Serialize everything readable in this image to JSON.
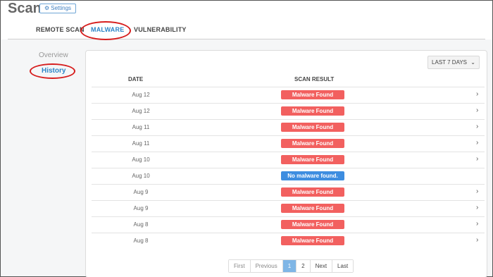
{
  "page": {
    "title": "Scan"
  },
  "header": {
    "settings_label": "Settings",
    "settings_icon": "gear-icon"
  },
  "tabs": [
    {
      "label": "REMOTE SCAN",
      "active": false
    },
    {
      "label": "MALWARE",
      "active": true
    },
    {
      "label": "VULNERABILITY",
      "active": false
    }
  ],
  "sidebar": {
    "items": [
      {
        "label": "Overview",
        "active": false
      },
      {
        "label": "History",
        "active": true
      }
    ]
  },
  "filter": {
    "range_label": "LAST 7 DAYS"
  },
  "table": {
    "columns": [
      "DATE",
      "SCAN RESULT"
    ],
    "rows": [
      {
        "date": "Aug 12",
        "result": "Malware Found",
        "status": "found",
        "has_details": true
      },
      {
        "date": "Aug 12",
        "result": "Malware Found",
        "status": "found",
        "has_details": true
      },
      {
        "date": "Aug 11",
        "result": "Malware Found",
        "status": "found",
        "has_details": true
      },
      {
        "date": "Aug 11",
        "result": "Malware Found",
        "status": "found",
        "has_details": true
      },
      {
        "date": "Aug 10",
        "result": "Malware Found",
        "status": "found",
        "has_details": true
      },
      {
        "date": "Aug 10",
        "result": "No malware found.",
        "status": "clean",
        "has_details": false
      },
      {
        "date": "Aug 9",
        "result": "Malware Found",
        "status": "found",
        "has_details": true
      },
      {
        "date": "Aug 9",
        "result": "Malware Found",
        "status": "found",
        "has_details": true
      },
      {
        "date": "Aug 8",
        "result": "Malware Found",
        "status": "found",
        "has_details": true
      },
      {
        "date": "Aug 8",
        "result": "Malware Found",
        "status": "found",
        "has_details": true
      }
    ]
  },
  "pagination": {
    "first": "First",
    "previous": "Previous",
    "pages": [
      "1",
      "2"
    ],
    "current_page": "1",
    "next": "Next",
    "last": "Last"
  },
  "colors": {
    "accent": "#2e86c8",
    "malware_found": "#f2605f",
    "no_malware": "#3d8de0",
    "callout": "#d61e1e"
  }
}
